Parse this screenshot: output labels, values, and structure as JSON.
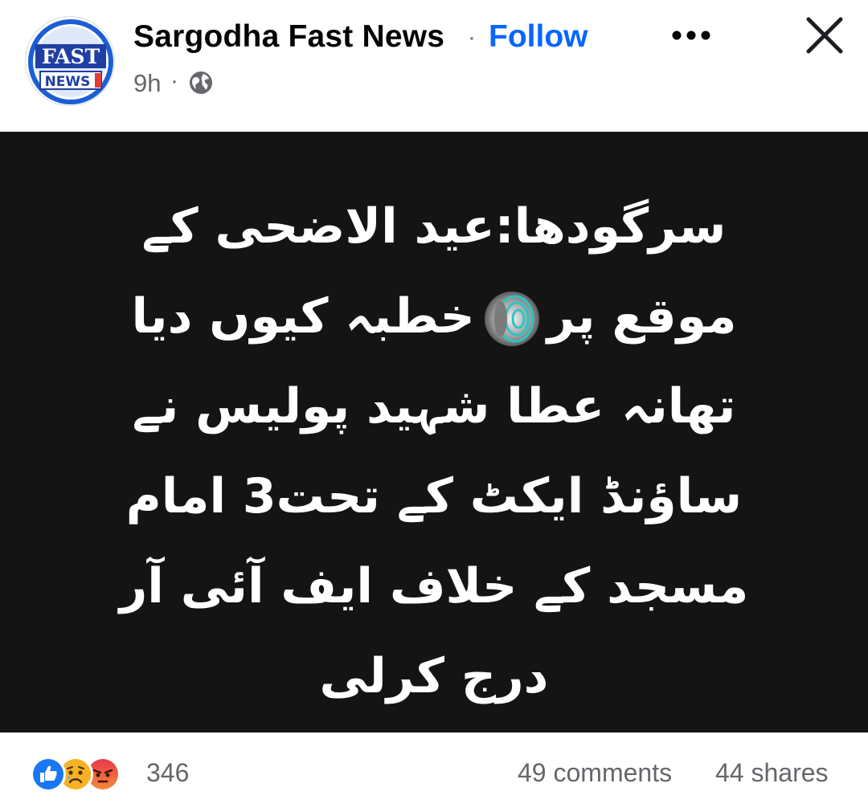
{
  "header": {
    "page_name": "Sargodha Fast News",
    "separator": "·",
    "follow_label": "Follow",
    "time": "9h",
    "time_separator": "·",
    "audience_icon": "globe-icon",
    "more_icon": "more-horizontal-icon",
    "close_icon": "close-icon",
    "avatar": {
      "text_top": "FAST",
      "text_bottom": "NEWS"
    }
  },
  "post": {
    "background_color": "#141414",
    "text_color": "#ffffff",
    "lines": [
      "سرگودھا:عید الاضحی کے",
      "خطبہ کیوں دیا",
      "موقع پر",
      "تھانہ عطا شہید پولیس نے",
      "ساؤنڈ ایکٹ کے تحت3 امام",
      "مسجد کے خلاف  ایف آئی آر",
      "درج کرلی"
    ],
    "inline_icon": "speaker-icon"
  },
  "footer": {
    "reaction_icons": [
      "like-icon",
      "sad-icon",
      "angry-icon"
    ],
    "reaction_count": "346",
    "comments": "49 comments",
    "shares": "44 shares"
  },
  "colors": {
    "accent": "#0866ff",
    "secondary_text": "#65676b",
    "primary_text": "#050505"
  }
}
